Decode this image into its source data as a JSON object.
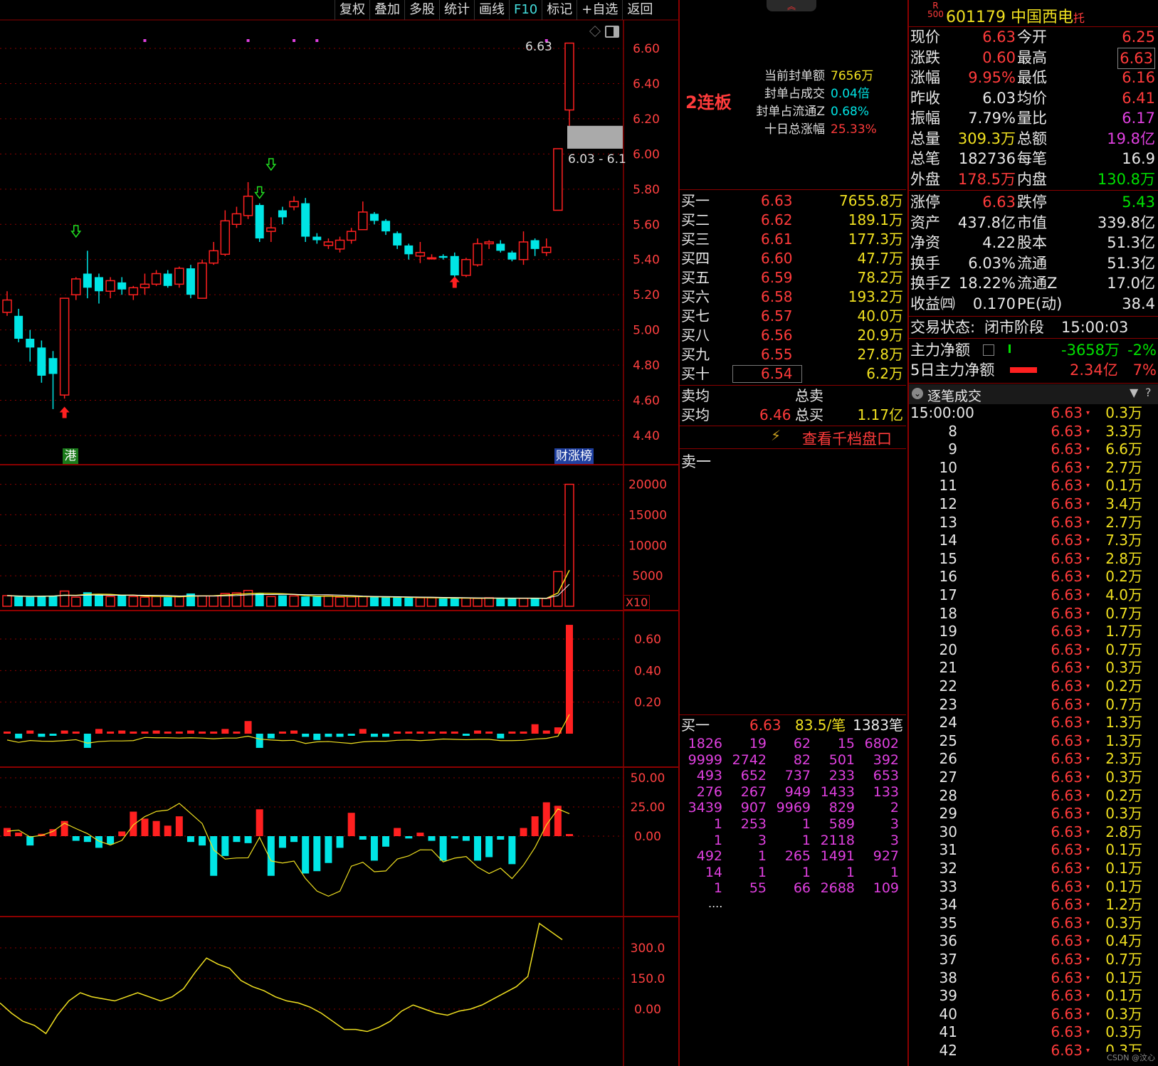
{
  "toolbar": [
    "复权",
    "叠加",
    "多股",
    "统计",
    "画线",
    "F10",
    "标记",
    "+自选",
    "返回"
  ],
  "chart": {
    "price_axis": [
      "6.60",
      "6.40",
      "6.20",
      "6.00",
      "5.80",
      "5.60",
      "5.40",
      "5.20",
      "5.00",
      "4.80",
      "4.60",
      "4.40"
    ],
    "high_label": "6.63",
    "gap_label": "6.03 - 6.1",
    "badge_hk": "港",
    "badge_rank": "财涨榜",
    "vol_axis": [
      "20000",
      "15000",
      "10000",
      "5000"
    ],
    "vol_unit": "X10",
    "ind1_axis": [
      "0.60",
      "0.40",
      "0.20"
    ],
    "ind2_axis": [
      "50.00",
      "25.00",
      "0.00"
    ],
    "ind3_axis": [
      "300.0",
      "150.0",
      "0.00"
    ]
  },
  "seal": {
    "limit_tag": "2连板",
    "items": [
      {
        "label": "当前封单额",
        "value": "7656万",
        "color": "#f0e020"
      },
      {
        "label": "封单占成交",
        "value": "0.04倍",
        "color": "#00e5e5"
      },
      {
        "label": "封单占流通Z",
        "value": "0.68%",
        "color": "#00e5e5"
      },
      {
        "label": "十日总涨幅",
        "value": "25.33%",
        "color": "#ff3b3b"
      }
    ]
  },
  "bids": [
    {
      "name": "买一",
      "price": "6.63",
      "vol": "7655.8万"
    },
    {
      "name": "买二",
      "price": "6.62",
      "vol": "189.1万"
    },
    {
      "name": "买三",
      "price": "6.61",
      "vol": "177.3万"
    },
    {
      "name": "买四",
      "price": "6.60",
      "vol": "47.7万"
    },
    {
      "name": "买五",
      "price": "6.59",
      "vol": "78.2万"
    },
    {
      "name": "买六",
      "price": "6.58",
      "vol": "193.2万"
    },
    {
      "name": "买七",
      "price": "6.57",
      "vol": "40.0万"
    },
    {
      "name": "买八",
      "price": "6.56",
      "vol": "20.9万"
    },
    {
      "name": "买九",
      "price": "6.55",
      "vol": "27.8万"
    },
    {
      "name": "买十",
      "price": "6.54",
      "vol": "6.2万"
    }
  ],
  "avg": {
    "sell_avg_label": "卖均",
    "sell_total_label": "总卖",
    "buy_avg_label": "买均",
    "buy_avg": "6.46",
    "buy_total_label": "总买",
    "buy_total": "1.17亿"
  },
  "depth_link": "查看千档盘口",
  "sell1_label": "卖一",
  "queue": {
    "header_name": "买一",
    "header_price": "6.63",
    "header_avg": "83.5/笔",
    "header_count": "1383笔",
    "rows": [
      [
        "1826",
        "19",
        "62",
        "15",
        "6802"
      ],
      [
        "9999",
        "2742",
        "82",
        "501",
        "392"
      ],
      [
        "493",
        "652",
        "737",
        "233",
        "653"
      ],
      [
        "276",
        "267",
        "949",
        "1433",
        "133"
      ],
      [
        "3439",
        "907",
        "9969",
        "829",
        "2"
      ],
      [
        "1",
        "253",
        "1",
        "589",
        "3"
      ],
      [
        "1",
        "3",
        "1",
        "2118",
        "3"
      ],
      [
        "492",
        "1",
        "265",
        "1491",
        "927"
      ],
      [
        "14",
        "1",
        "1",
        "1",
        "1"
      ],
      [
        "1",
        "55",
        "66",
        "2688",
        "109"
      ]
    ],
    "more": "...."
  },
  "stock": {
    "r_tag": "R",
    "r_num": "500",
    "code": "601179",
    "name": "中国西电",
    "suffix": "托"
  },
  "quote": [
    {
      "l1": "现价",
      "v1": "6.63",
      "c1": "#ff3b3b",
      "l2": "今开",
      "v2": "6.25",
      "c2": "#ff3b3b"
    },
    {
      "l1": "涨跌",
      "v1": "0.60",
      "c1": "#ff3b3b",
      "l2": "最高",
      "v2": "6.63",
      "c2": "#ff3b3b"
    },
    {
      "l1": "涨幅",
      "v1": "9.95%",
      "c1": "#ff3b3b",
      "l2": "最低",
      "v2": "6.16",
      "c2": "#ff3b3b"
    },
    {
      "l1": "昨收",
      "v1": "6.03",
      "c1": "#e8e8e8",
      "l2": "均价",
      "v2": "6.41",
      "c2": "#ff3b3b"
    },
    {
      "l1": "振幅",
      "v1": "7.79%",
      "c1": "#e8e8e8",
      "l2": "量比",
      "v2": "6.17",
      "c2": "#e040e0"
    },
    {
      "l1": "总量",
      "v1": "309.3万",
      "c1": "#f0e020",
      "l2": "总额",
      "v2": "19.8亿",
      "c2": "#e040e0"
    },
    {
      "l1": "总笔",
      "v1": "182736",
      "c1": "#e8e8e8",
      "l2": "每笔",
      "v2": "16.9",
      "c2": "#e8e8e8"
    },
    {
      "l1": "外盘",
      "v1": "178.5万",
      "c1": "#ff3b3b",
      "l2": "内盘",
      "v2": "130.8万",
      "c2": "#00e000"
    },
    {
      "l1": "涨停",
      "v1": "6.63",
      "c1": "#ff3b3b",
      "l2": "跌停",
      "v2": "5.43",
      "c2": "#00e000"
    },
    {
      "l1": "资产",
      "v1": "437.8亿",
      "c1": "#e8e8e8",
      "l2": "市值",
      "v2": "339.8亿",
      "c2": "#e8e8e8"
    },
    {
      "l1": "净资",
      "v1": "4.22",
      "c1": "#e8e8e8",
      "l2": "股本",
      "v2": "51.3亿",
      "c2": "#e8e8e8"
    },
    {
      "l1": "换手",
      "v1": "6.03%",
      "c1": "#e8e8e8",
      "l2": "流通",
      "v2": "51.3亿",
      "c2": "#e8e8e8"
    },
    {
      "l1": "换手Z",
      "v1": "18.22%",
      "c1": "#e8e8e8",
      "l2": "流通Z",
      "v2": "17.0亿",
      "c2": "#e8e8e8"
    },
    {
      "l1": "收益㈣",
      "v1": "0.170",
      "c1": "#e8e8e8",
      "l2": "PE(动)",
      "v2": "38.4",
      "c2": "#e8e8e8"
    }
  ],
  "status": {
    "label": "交易状态:",
    "value": "闭市阶段",
    "time": "15:00:03"
  },
  "flow": [
    {
      "label": "主力净额",
      "value": "-3658万",
      "pct": "-2%",
      "color": "#00e000"
    },
    {
      "label": "5日主力净额",
      "value": "2.34亿",
      "pct": "7%",
      "color": "#ff3b3b"
    }
  ],
  "ticks_title": "逐笔成交",
  "ticks": [
    {
      "t": "15:00:00",
      "p": "6.63",
      "v": "0.3万"
    },
    {
      "t": "8",
      "p": "6.63",
      "v": "3.3万"
    },
    {
      "t": "9",
      "p": "6.63",
      "v": "6.6万"
    },
    {
      "t": "10",
      "p": "6.63",
      "v": "2.7万"
    },
    {
      "t": "11",
      "p": "6.63",
      "v": "0.1万"
    },
    {
      "t": "12",
      "p": "6.63",
      "v": "3.4万"
    },
    {
      "t": "13",
      "p": "6.63",
      "v": "2.7万"
    },
    {
      "t": "14",
      "p": "6.63",
      "v": "7.3万"
    },
    {
      "t": "15",
      "p": "6.63",
      "v": "2.8万"
    },
    {
      "t": "16",
      "p": "6.63",
      "v": "0.2万"
    },
    {
      "t": "17",
      "p": "6.63",
      "v": "4.0万"
    },
    {
      "t": "18",
      "p": "6.63",
      "v": "0.7万"
    },
    {
      "t": "19",
      "p": "6.63",
      "v": "1.7万"
    },
    {
      "t": "20",
      "p": "6.63",
      "v": "0.7万"
    },
    {
      "t": "21",
      "p": "6.63",
      "v": "0.3万"
    },
    {
      "t": "22",
      "p": "6.63",
      "v": "0.2万"
    },
    {
      "t": "23",
      "p": "6.63",
      "v": "0.7万"
    },
    {
      "t": "24",
      "p": "6.63",
      "v": "1.3万"
    },
    {
      "t": "25",
      "p": "6.63",
      "v": "1.3万"
    },
    {
      "t": "26",
      "p": "6.63",
      "v": "2.3万"
    },
    {
      "t": "27",
      "p": "6.63",
      "v": "0.3万"
    },
    {
      "t": "28",
      "p": "6.63",
      "v": "0.2万"
    },
    {
      "t": "29",
      "p": "6.63",
      "v": "0.3万"
    },
    {
      "t": "30",
      "p": "6.63",
      "v": "2.8万"
    },
    {
      "t": "31",
      "p": "6.63",
      "v": "0.1万"
    },
    {
      "t": "32",
      "p": "6.63",
      "v": "0.1万"
    },
    {
      "t": "33",
      "p": "6.63",
      "v": "0.1万"
    },
    {
      "t": "34",
      "p": "6.63",
      "v": "1.2万"
    },
    {
      "t": "35",
      "p": "6.63",
      "v": "0.3万"
    },
    {
      "t": "36",
      "p": "6.63",
      "v": "0.4万"
    },
    {
      "t": "37",
      "p": "6.63",
      "v": "0.7万"
    },
    {
      "t": "38",
      "p": "6.63",
      "v": "0.1万"
    },
    {
      "t": "39",
      "p": "6.63",
      "v": "0.1万"
    },
    {
      "t": "40",
      "p": "6.63",
      "v": "0.3万"
    },
    {
      "t": "41",
      "p": "6.63",
      "v": "0.3万"
    },
    {
      "t": "42",
      "p": "6.63",
      "v": "0.3万"
    }
  ],
  "watermark": "CSDN @汶心",
  "colors": {
    "up": "#ff2020",
    "down": "#00e5e5",
    "ma": "#f0e020",
    "grid": "#8b0000"
  },
  "candles": [
    [
      5.1,
      5.17,
      5.22,
      5.08
    ],
    [
      5.08,
      4.95,
      5.12,
      4.93
    ],
    [
      4.95,
      4.9,
      5.0,
      4.82
    ],
    [
      4.9,
      4.74,
      4.94,
      4.7
    ],
    [
      4.84,
      4.75,
      4.88,
      4.55
    ],
    [
      4.63,
      5.18,
      5.18,
      4.61
    ],
    [
      5.2,
      5.29,
      5.3,
      5.17
    ],
    [
      5.32,
      5.24,
      5.45,
      5.18
    ],
    [
      5.3,
      5.22,
      5.32,
      5.15
    ],
    [
      5.22,
      5.28,
      5.3,
      5.18
    ],
    [
      5.27,
      5.23,
      5.3,
      5.2
    ],
    [
      5.2,
      5.24,
      5.25,
      5.17
    ],
    [
      5.24,
      5.26,
      5.32,
      5.2
    ],
    [
      5.26,
      5.32,
      5.34,
      5.25
    ],
    [
      5.32,
      5.25,
      5.34,
      5.24
    ],
    [
      5.26,
      5.35,
      5.36,
      5.24
    ],
    [
      5.35,
      5.2,
      5.37,
      5.18
    ],
    [
      5.18,
      5.38,
      5.4,
      5.18
    ],
    [
      5.38,
      5.45,
      5.5,
      5.37
    ],
    [
      5.43,
      5.62,
      5.68,
      5.42
    ],
    [
      5.6,
      5.66,
      5.7,
      5.58
    ],
    [
      5.65,
      5.76,
      5.84,
      5.63
    ],
    [
      5.71,
      5.52,
      5.72,
      5.5
    ],
    [
      5.56,
      5.58,
      5.64,
      5.5
    ],
    [
      5.68,
      5.64,
      5.7,
      5.6
    ],
    [
      5.7,
      5.73,
      5.76,
      5.68
    ],
    [
      5.72,
      5.53,
      5.75,
      5.5
    ],
    [
      5.53,
      5.51,
      5.55,
      5.49
    ],
    [
      5.48,
      5.5,
      5.52,
      5.46
    ],
    [
      5.46,
      5.51,
      5.53,
      5.44
    ],
    [
      5.51,
      5.56,
      5.58,
      5.49
    ],
    [
      5.57,
      5.67,
      5.73,
      5.57
    ],
    [
      5.66,
      5.62,
      5.67,
      5.6
    ],
    [
      5.62,
      5.56,
      5.63,
      5.54
    ],
    [
      5.55,
      5.48,
      5.56,
      5.46
    ],
    [
      5.48,
      5.43,
      5.49,
      5.4
    ],
    [
      5.42,
      5.44,
      5.5,
      5.38
    ],
    [
      5.41,
      5.41,
      5.43,
      5.4
    ],
    [
      5.42,
      5.41,
      5.43,
      5.4
    ],
    [
      5.42,
      5.31,
      5.44,
      5.3
    ],
    [
      5.31,
      5.4,
      5.41,
      5.3
    ],
    [
      5.37,
      5.49,
      5.52,
      5.36
    ],
    [
      5.49,
      5.5,
      5.51,
      5.46
    ],
    [
      5.49,
      5.45,
      5.51,
      5.44
    ],
    [
      5.44,
      5.4,
      5.45,
      5.39
    ],
    [
      5.4,
      5.5,
      5.56,
      5.37
    ],
    [
      5.51,
      5.46,
      5.52,
      5.42
    ],
    [
      5.44,
      5.47,
      5.52,
      5.42
    ],
    [
      5.68,
      6.03,
      6.03,
      5.68
    ],
    [
      6.25,
      6.63,
      6.63,
      6.16
    ]
  ],
  "volumes": [
    1750,
    1600,
    1550,
    1700,
    1750,
    2500,
    1500,
    2300,
    1900,
    1600,
    1800,
    1600,
    1500,
    1600,
    1500,
    1600,
    2100,
    1700,
    1700,
    2100,
    2200,
    2600,
    2100,
    1600,
    1800,
    1700,
    1600,
    1600,
    1700,
    1500,
    1550,
    1600,
    1550,
    1450,
    1450,
    1400,
    1400,
    1400,
    1300,
    1300,
    1350,
    1300,
    1400,
    1300,
    1300,
    1300,
    1300,
    1300,
    5700,
    20000
  ],
  "ind1": [
    0.0,
    -0.03,
    0.02,
    -0.02,
    -0.01,
    0.02,
    0.0,
    -0.09,
    0.03,
    0.01,
    0.02,
    0.01,
    0.01,
    0.02,
    0.01,
    0.01,
    0.02,
    0.0,
    0.0,
    0.03,
    0.01,
    0.08,
    -0.09,
    -0.03,
    0.01,
    0.02,
    -0.02,
    -0.04,
    -0.02,
    -0.02,
    -0.01,
    0.03,
    -0.02,
    -0.02,
    0.01,
    0.0,
    0.01,
    0.0,
    0.01,
    0.0,
    -0.01,
    0.02,
    0.0,
    -0.03,
    0.0,
    0.0,
    0.06,
    0.02,
    0.04,
    0.69,
    -0.12
  ],
  "ind2": [
    7,
    3,
    -8,
    2,
    6,
    13,
    -4,
    -5,
    -10,
    -7,
    4,
    21,
    15,
    13,
    9,
    17,
    -5,
    -8,
    -34,
    -17,
    -5,
    -6,
    23,
    -34,
    -10,
    -5,
    -32,
    -30,
    -23,
    -10,
    20,
    -3,
    -21,
    -9,
    7,
    -2,
    3,
    -4,
    -21,
    -2,
    -4,
    -21,
    -18,
    -3,
    -24,
    7,
    17,
    29,
    26,
    1
  ],
  "ind3": [
    30,
    -20,
    -60,
    -80,
    -120,
    -30,
    40,
    80,
    60,
    50,
    40,
    60,
    80,
    60,
    40,
    60,
    100,
    180,
    250,
    220,
    200,
    140,
    110,
    90,
    60,
    40,
    30,
    10,
    -20,
    -60,
    -100,
    -100,
    -110,
    -90,
    -60,
    -10,
    20,
    0,
    -20,
    -30,
    -10,
    0,
    20,
    50,
    80,
    110,
    160,
    420,
    380,
    340
  ]
}
